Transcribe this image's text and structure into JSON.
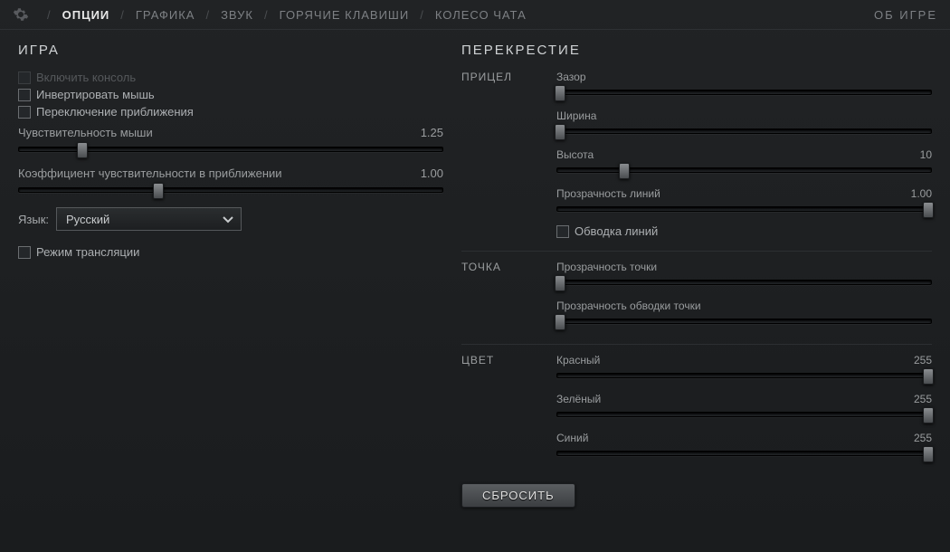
{
  "nav": {
    "tabs": [
      "ОПЦИИ",
      "ГРАФИКА",
      "ЗВУК",
      "ГОРЯЧИЕ КЛАВИШИ",
      "КОЛЕСО ЧАТА"
    ],
    "active_index": 0,
    "about": "ОБ ИГРЕ"
  },
  "game": {
    "title": "ИГРА",
    "enable_console": {
      "label": "Включить консоль",
      "checked": false,
      "disabled": true
    },
    "invert_mouse": {
      "label": "Инвертировать мышь",
      "checked": false
    },
    "toggle_zoom": {
      "label": "Переключение приближения",
      "checked": false
    },
    "mouse_sens": {
      "label": "Чувствительность мыши",
      "value": "1.25",
      "percent": 15
    },
    "zoom_sens": {
      "label": "Коэффициент чувствительности в приближении",
      "value": "1.00",
      "percent": 33
    },
    "language": {
      "label": "Язык:",
      "value": "Русский"
    },
    "stream_mode": {
      "label": "Режим трансляции",
      "checked": false
    }
  },
  "cross": {
    "title": "ПЕРЕКРЕСТИЕ",
    "groups": {
      "sight": {
        "label": "ПРИЦЕЛ"
      },
      "dot": {
        "label": "ТОЧКА"
      },
      "color": {
        "label": "ЦВЕТ"
      }
    },
    "gap": {
      "label": "Зазор",
      "value": "",
      "percent": 1
    },
    "width": {
      "label": "Ширина",
      "value": "",
      "percent": 1
    },
    "height": {
      "label": "Высота",
      "value": "10",
      "percent": 18
    },
    "line_alpha": {
      "label": "Прозрачность линий",
      "value": "1.00",
      "percent": 99
    },
    "outline": {
      "label": "Обводка линий",
      "checked": false
    },
    "dot_alpha": {
      "label": "Прозрачность точки",
      "value": "",
      "percent": 1
    },
    "dot_outline_alpha": {
      "label": "Прозрачность обводки точки",
      "value": "",
      "percent": 1
    },
    "red": {
      "label": "Красный",
      "value": "255",
      "percent": 99
    },
    "green": {
      "label": "Зелёный",
      "value": "255",
      "percent": 99
    },
    "blue": {
      "label": "Синий",
      "value": "255",
      "percent": 99
    },
    "reset": "СБРОСИТЬ"
  }
}
